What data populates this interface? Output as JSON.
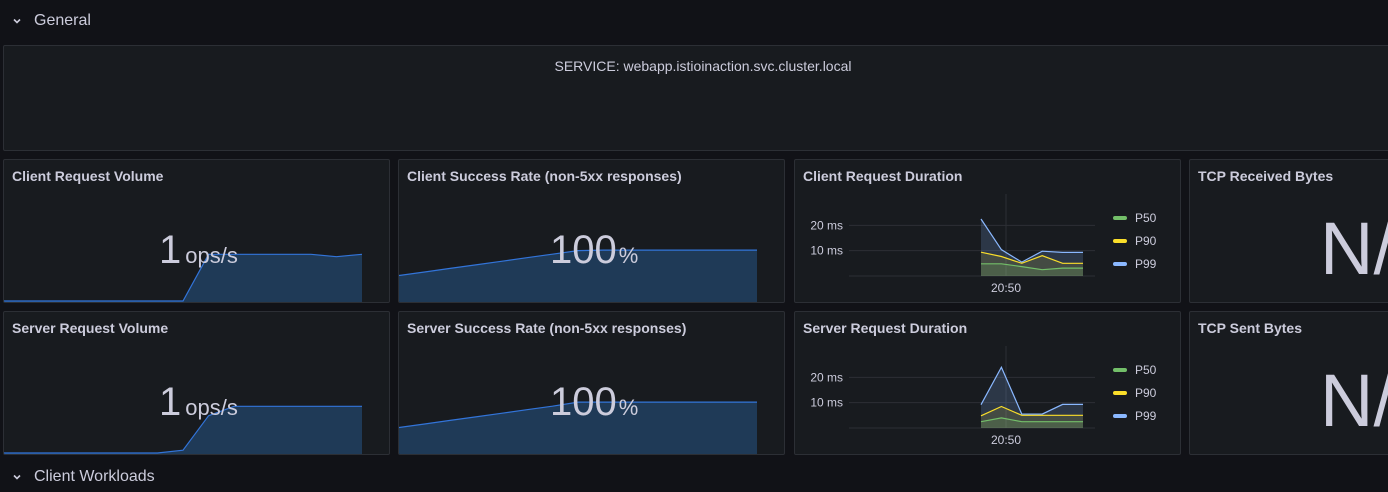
{
  "rows": {
    "general": {
      "label": "General"
    },
    "client_workloads": {
      "label": "Client Workloads"
    }
  },
  "service_panel": {
    "text": "SERVICE: webapp.istioinaction.svc.cluster.local"
  },
  "panels": {
    "client_request_volume": {
      "title": "Client Request Volume",
      "value": "1",
      "unit": "ops/s",
      "sparkline": [
        0,
        0,
        0,
        0,
        0,
        0,
        0,
        0,
        1,
        1,
        1,
        1,
        1,
        0.95,
        1
      ],
      "spark_max": 1.2
    },
    "client_success_rate": {
      "title": "Client Success Rate (non-5xx responses)",
      "value": "100",
      "unit": "%",
      "sparkline": [
        0.5,
        0.57,
        0.64,
        0.71,
        0.78,
        0.85,
        0.92,
        0.99,
        1,
        1,
        1,
        1,
        1,
        1,
        1
      ],
      "spark_max": 1.1
    },
    "client_request_duration": {
      "title": "Client Request Duration"
    },
    "tcp_received_bytes": {
      "title": "TCP Received Bytes",
      "value": "N/A"
    },
    "server_request_volume": {
      "title": "Server Request Volume",
      "value": "1",
      "unit": "ops/s",
      "sparkline": [
        0,
        0,
        0,
        0,
        0,
        0,
        0,
        0.06,
        0.8,
        1,
        1,
        1,
        1,
        1,
        1
      ],
      "spark_max": 1.2
    },
    "server_success_rate": {
      "title": "Server Success Rate (non-5xx responses)",
      "value": "100",
      "unit": "%",
      "sparkline": [
        0.5,
        0.57,
        0.64,
        0.71,
        0.78,
        0.85,
        0.92,
        1,
        1,
        1,
        1,
        1,
        1,
        1,
        1
      ],
      "spark_max": 1.1
    },
    "server_request_duration": {
      "title": "Server Request Duration"
    },
    "tcp_sent_bytes": {
      "title": "TCP Sent Bytes",
      "value": "N/A"
    }
  },
  "colors": {
    "spark_line": "#3274d9",
    "spark_fill": "#1f3a57",
    "p50": "#73bf69",
    "p90": "#fade2a",
    "p99": "#8ab8ff",
    "grid": "#2c2f35"
  },
  "chart_data": [
    {
      "type": "line",
      "title": "Client Request Duration",
      "x_tick": "20:50",
      "y_ticks": [
        "10 ms",
        "20 ms"
      ],
      "ylim": [
        0,
        30
      ],
      "series": [
        {
          "name": "P50",
          "values": [
            4.8,
            4.8,
            3.7,
            2.5,
            3.1,
            3.1
          ]
        },
        {
          "name": "P90",
          "values": [
            9.4,
            7.7,
            5.0,
            8.0,
            5.0,
            5.0
          ]
        },
        {
          "name": "P99",
          "values": [
            22.5,
            10.4,
            5.5,
            9.8,
            9.3,
            9.3
          ]
        }
      ]
    },
    {
      "type": "line",
      "title": "Server Request Duration",
      "x_tick": "20:50",
      "y_ticks": [
        "10 ms",
        "20 ms"
      ],
      "ylim": [
        0,
        30
      ],
      "series": [
        {
          "name": "P50",
          "values": [
            2.5,
            4.0,
            2.5,
            2.5,
            2.5,
            2.5
          ]
        },
        {
          "name": "P90",
          "values": [
            4.8,
            8.5,
            5.0,
            5.0,
            5.0,
            5.0
          ]
        },
        {
          "name": "P99",
          "values": [
            9.2,
            24.0,
            5.5,
            5.5,
            9.3,
            9.3
          ]
        }
      ]
    }
  ]
}
